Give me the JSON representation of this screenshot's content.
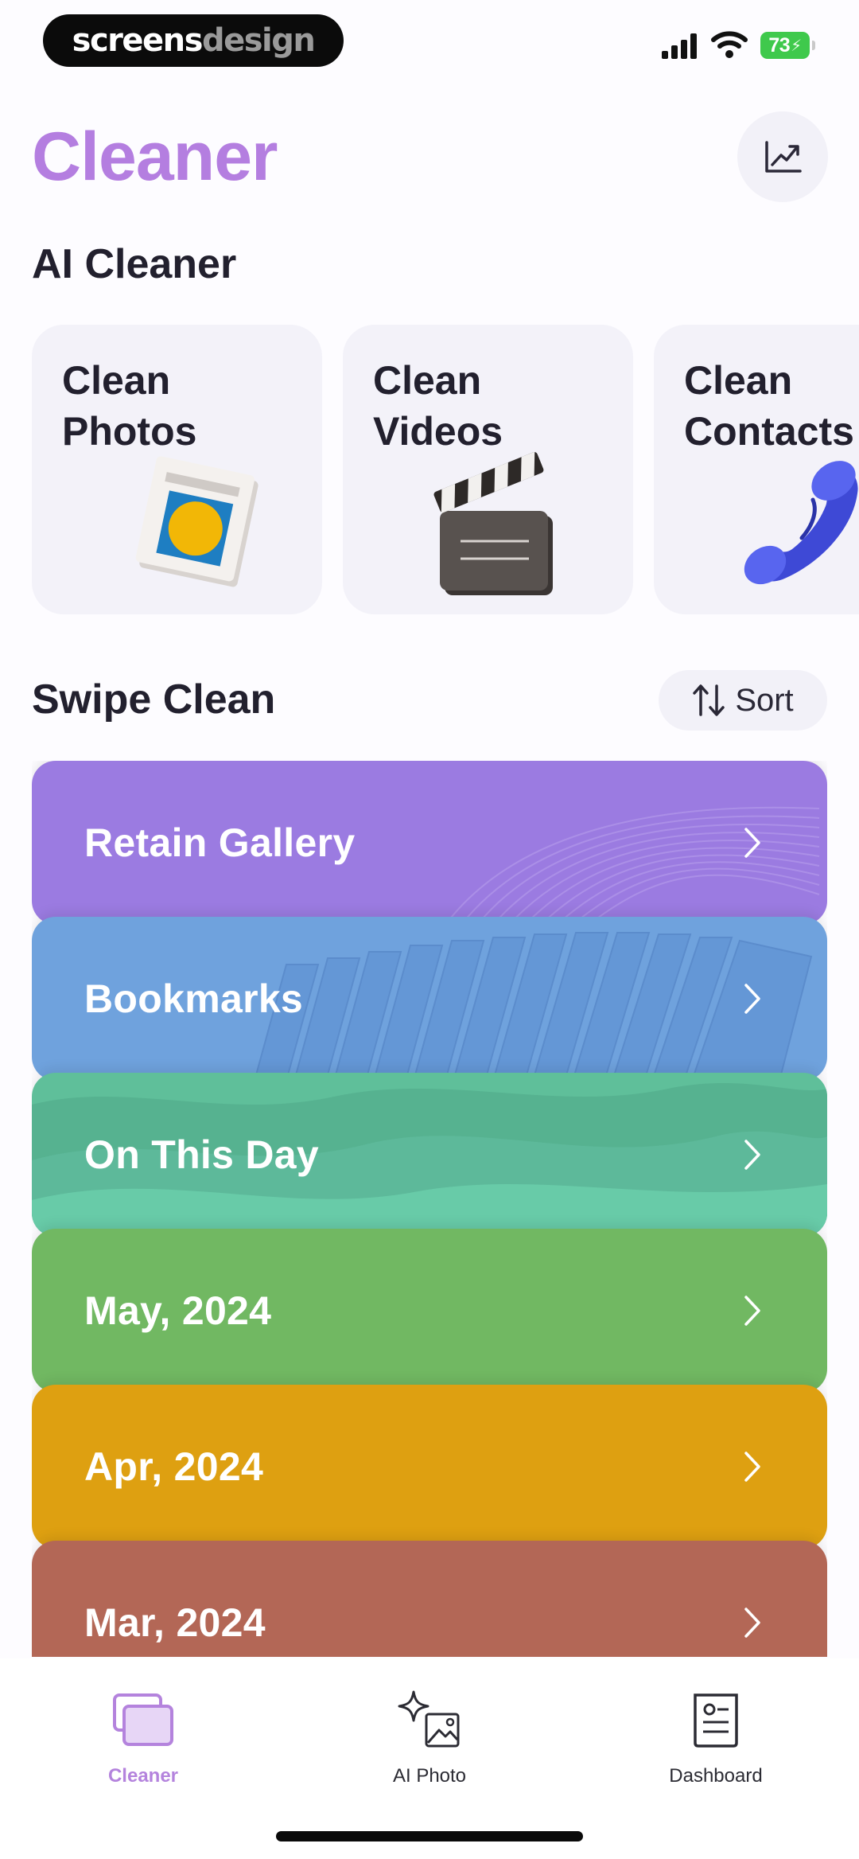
{
  "status_bar": {
    "brand_part1": "screens",
    "brand_part2": "design",
    "battery": "73"
  },
  "header": {
    "title": "Cleaner",
    "stats_icon": "trend-chart-icon"
  },
  "ai_cleaner": {
    "title": "AI Cleaner",
    "cards": [
      {
        "line1": "Clean",
        "line2": "Photos",
        "icon": "picture-frame-icon"
      },
      {
        "line1": "Clean",
        "line2": "Videos",
        "icon": "clapperboard-icon"
      },
      {
        "line1": "Clean",
        "line2": "Contacts",
        "icon": "telephone-icon"
      }
    ]
  },
  "swipe_clean": {
    "title": "Swipe Clean",
    "sort_label": "Sort",
    "items": [
      {
        "label": "Retain Gallery",
        "color": "#9b7be1"
      },
      {
        "label": "Bookmarks",
        "color": "#6fa2dd"
      },
      {
        "label": "On This Day",
        "color": "#5fbf9a"
      },
      {
        "label": "May, 2024",
        "color": "#71b862"
      },
      {
        "label": "Apr, 2024",
        "color": "#dea011"
      },
      {
        "label": "Mar, 2024",
        "color": "#b36756"
      }
    ]
  },
  "tabs": [
    {
      "label": "Cleaner",
      "active": true,
      "icon": "stacked-cards-icon"
    },
    {
      "label": "AI Photo",
      "active": false,
      "icon": "sparkle-image-icon"
    },
    {
      "label": "Dashboard",
      "active": false,
      "icon": "document-icon"
    }
  ],
  "colors": {
    "accent": "#b47ee0",
    "background": "#fdfcff",
    "card_background": "#f3f2f9"
  }
}
